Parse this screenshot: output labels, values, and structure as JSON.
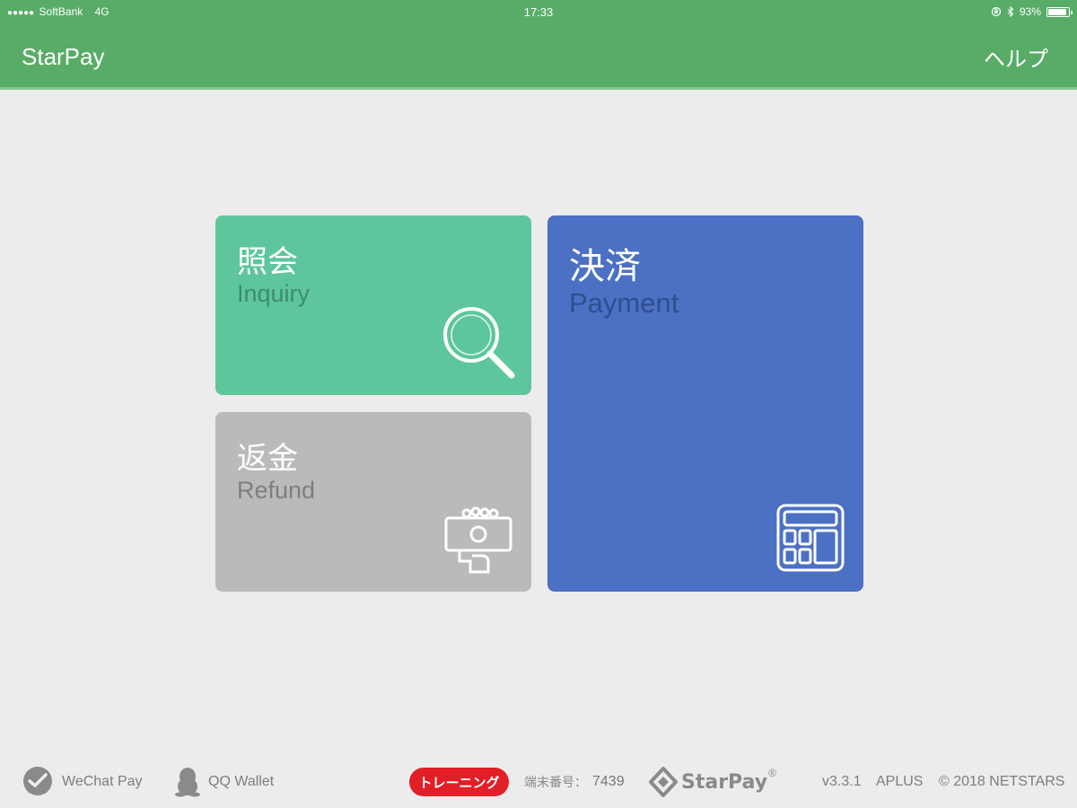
{
  "status_bar": {
    "signal_dots": "●●●●●",
    "carrier": "SoftBank",
    "network": "4G",
    "time": "17:33",
    "battery_percent": "93%",
    "battery_level": 0.93
  },
  "nav": {
    "title": "StarPay",
    "help_label": "ヘルプ"
  },
  "tiles": {
    "inquiry": {
      "ja": "照会",
      "en": "Inquiry",
      "color": "#5dc69c",
      "icon": "search-icon"
    },
    "refund": {
      "ja": "返金",
      "en": "Refund",
      "color": "#bababa",
      "icon": "refund-cash-icon"
    },
    "payment": {
      "ja": "決済",
      "en": "Payment",
      "color": "#4b70c4",
      "icon": "calculator-icon"
    }
  },
  "footer": {
    "wechat_label": "WeChat Pay",
    "qq_label": "QQ Wallet",
    "training_label": "トレーニング",
    "terminal_label": "端末番号：",
    "terminal_number": "7439",
    "brand": "StarPay",
    "registered_mark": "®",
    "version": "v3.3.1",
    "partner": "APLUS",
    "copyright": "© 2018 NETSTARS"
  },
  "colors": {
    "header_green": "#58ac67",
    "background": "#ececec",
    "training_red": "#e21e26"
  }
}
